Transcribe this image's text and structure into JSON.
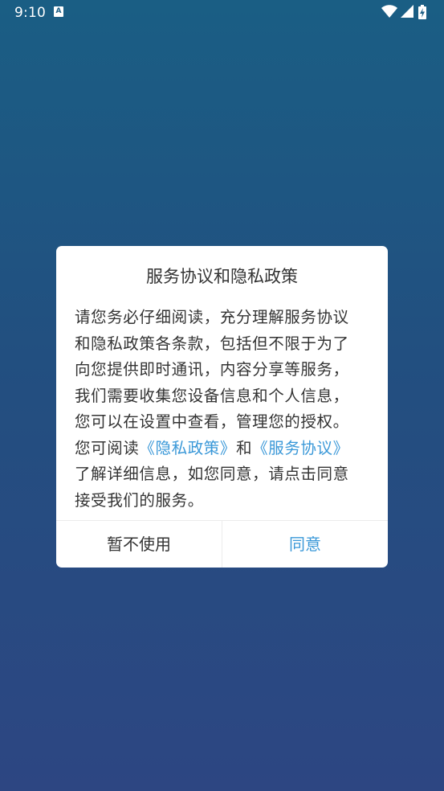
{
  "status_bar": {
    "time": "9:10",
    "icons": [
      "a-notification-icon",
      "wifi-icon",
      "cellular-signal-icon",
      "battery-charging-icon"
    ]
  },
  "dialog": {
    "title": "服务协议和隐私政策",
    "body": {
      "line1": "请您务必仔细阅读，充分理解服务协议",
      "line2": "和隐私政策各条款，包括但不限于为了",
      "line3": "向您提供即时通讯，内容分享等服务，",
      "line4": "我们需要收集您设备信息和个人信息，",
      "line5": "您可以在设置中查看，管理您的授权。",
      "line6_prefix": "您可阅读",
      "privacy_link": "《隐私政策》",
      "line6_and": "和",
      "service_link": "《服务协议》",
      "line7": "了解详细信息，如您同意，请点击同意",
      "line8": "接受我们的服务。"
    },
    "buttons": {
      "decline": "暂不使用",
      "accept": "同意"
    }
  },
  "colors": {
    "link": "#3a98d8",
    "text": "#333333",
    "background_top": "#1a5e84",
    "background_bottom": "#2d4682"
  }
}
